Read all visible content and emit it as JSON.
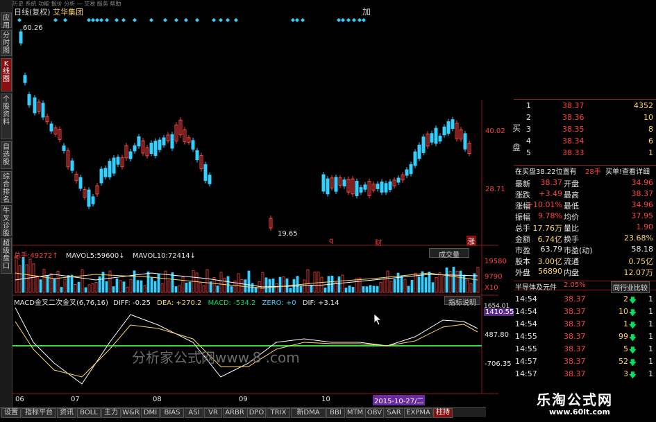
{
  "topbar_text": "历史 系统 功能 报价 分析 — 交易 服务 帮助",
  "title": {
    "line": "日线(复权)",
    "name": "艾华集团",
    "right_btn": "加"
  },
  "left_tabs": [
    "应用",
    "分时图",
    "K线图",
    "个股资料",
    "自选股",
    "综合排名",
    "牛叉诊股",
    "超级盘口"
  ],
  "main_chart": {
    "price_high": "60.26",
    "price_low": "19.65",
    "right_labels": [
      "40.02",
      "28.71"
    ],
    "markers": [
      "q",
      "财",
      "涨"
    ]
  },
  "vol_panel": {
    "label_total": "总手:",
    "total": "49272",
    "vol5_label": "MAVOL5:",
    "vol5": "59600",
    "vol10_label": "MAVOL10:",
    "vol10": "72414",
    "button": "成交量",
    "scale": [
      "19580",
      "9790",
      "X10"
    ]
  },
  "macd_panel": {
    "name": "MACD金叉二次金叉(6,76,16)",
    "diff": "DIFF: -0.25",
    "dea": "DEA: +270.2",
    "macd": "MACD: -534.2",
    "zero": "ZERO: +0",
    "dif": "DIF: +3.14",
    "button": "指标说明",
    "scale": [
      "1654.01",
      "1410.55",
      "487.80",
      "-706.35"
    ],
    "watermark": "分析家公式网www.8   .com"
  },
  "time_axis": [
    "06",
    "07",
    "08",
    "09",
    "10"
  ],
  "time_cursor": "2015-10-27/二",
  "right_panel": {
    "side_label": [
      "买",
      "盘"
    ],
    "bids": [
      {
        "n": "1",
        "price": "38.37",
        "vol": "4352"
      },
      {
        "n": "2",
        "price": "38.36",
        "vol": "10"
      },
      {
        "n": "3",
        "price": "38.35",
        "vol": "8"
      },
      {
        "n": "4",
        "price": "38.34",
        "vol": "6"
      },
      {
        "n": "5",
        "price": "38.33",
        "vol": "1"
      }
    ],
    "notice": "在买盘38.22位置有",
    "notice_vol": "28手",
    "notice_btn": "买单!查看详细",
    "stats": [
      {
        "l": "最新",
        "v": "38.37",
        "l2": "开盘",
        "v2": "34.96"
      },
      {
        "l": "涨跌",
        "v": "+3.49",
        "l2": "最高",
        "v2": "38.37"
      },
      {
        "l": "涨幅",
        "v": "+10.01%",
        "l2": "最低",
        "v2": "34.96"
      },
      {
        "l": "振幅",
        "v": "9.78%",
        "l2": "均价",
        "v2": "37.95"
      },
      {
        "l": "总手",
        "v": "17.76万",
        "l2": "量比",
        "v2": "1.90"
      },
      {
        "l": "金额",
        "v": "6.74亿",
        "l2": "换手",
        "v2": "23.68%"
      },
      {
        "l": "市盈",
        "v": "63.79",
        "l2": "市盈(动)",
        "v2": "58.18"
      },
      {
        "l": "股本",
        "v": "3.00亿",
        "l2": "流通",
        "v2": "0.75亿"
      },
      {
        "l": "外盘",
        "v": "56890",
        "l2": "内盘",
        "v2": "12.07万"
      }
    ],
    "industry": "半导体及元件",
    "industry_pct": "2.05%",
    "industry_btn": "同行业比较",
    "ticks": [
      {
        "t": "14:54",
        "p": "38.37",
        "v": "2",
        "c": "1"
      },
      {
        "t": "14:54",
        "p": "38.37",
        "v": "10",
        "c": "1"
      },
      {
        "t": "14:54",
        "p": "38.37",
        "v": "1",
        "c": "1"
      },
      {
        "t": "14:55",
        "p": "38.37",
        "v": "99",
        "c": "1"
      },
      {
        "t": "14:55",
        "p": "38.37",
        "v": "5",
        "c": "1"
      },
      {
        "t": "14:57",
        "p": "38.37",
        "v": "52",
        "c": "1"
      },
      {
        "t": "14:57",
        "p": "38.37",
        "v": "3",
        "c": "1"
      }
    ]
  },
  "bottom_tabs": [
    "设置",
    "指标平台",
    "资讯",
    "BOLL",
    "主力",
    "W&R",
    "DMI",
    "BIAS",
    "ASI",
    "VR",
    "ARBR",
    "DPO",
    "TRIX",
    "新DMA",
    "BBI",
    "MTM",
    "OBV",
    "SAR",
    "EXPMA",
    "柱持"
  ],
  "watermark_site": {
    "cn": "乐淘公式网",
    "url": "www.60lt.com"
  },
  "colors": {
    "up": "#ff4242",
    "down": "#35d0ff",
    "panel_border": "#8a1a1a",
    "macd_pos": "#ff3030",
    "macd_neg": "#30e040"
  }
}
